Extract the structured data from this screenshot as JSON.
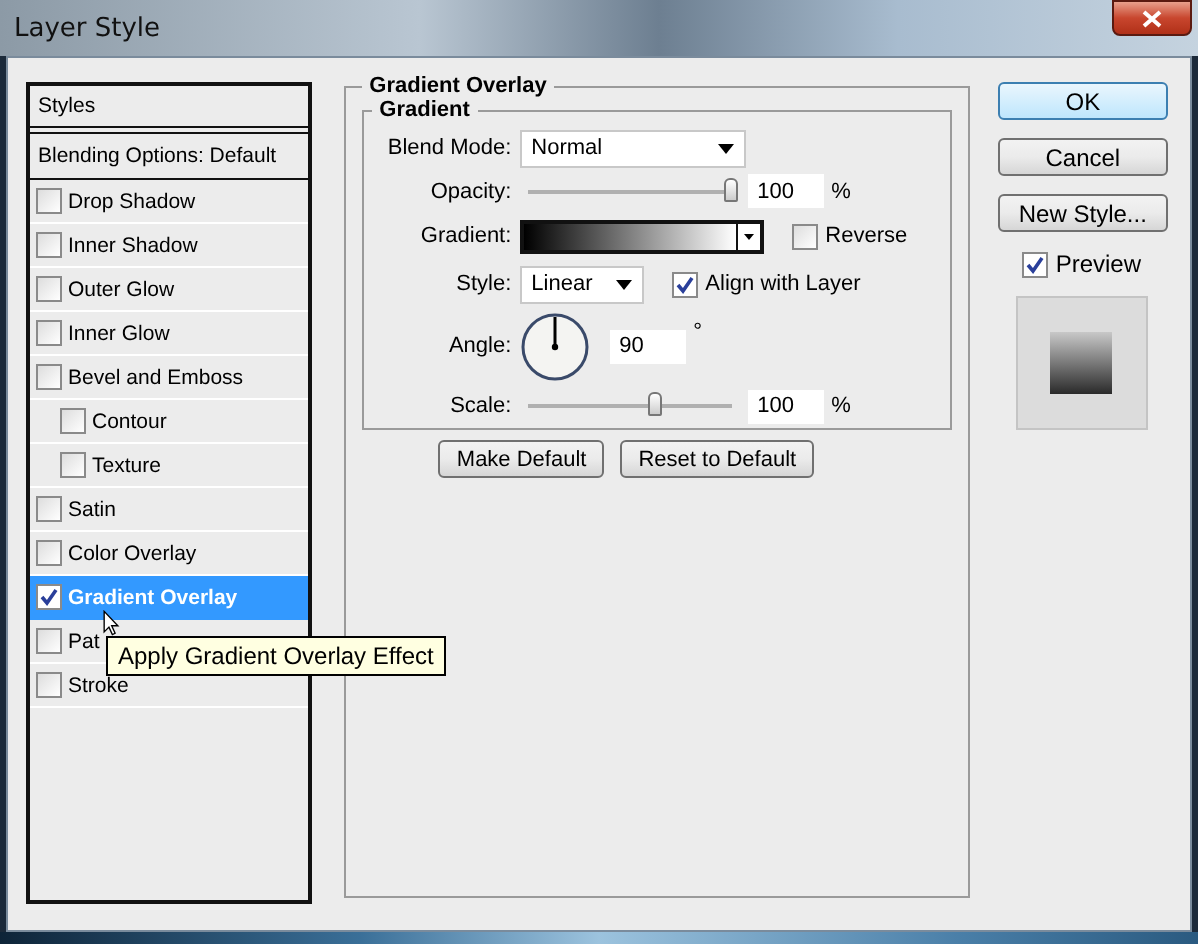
{
  "window": {
    "title": "Layer Style"
  },
  "styles_panel": {
    "title": "Styles",
    "blending_options": "Blending Options: Default",
    "items": [
      {
        "label": "Drop Shadow",
        "checked": false,
        "selected": false
      },
      {
        "label": "Inner Shadow",
        "checked": false,
        "selected": false
      },
      {
        "label": "Outer Glow",
        "checked": false,
        "selected": false
      },
      {
        "label": "Inner Glow",
        "checked": false,
        "selected": false
      },
      {
        "label": "Bevel and Emboss",
        "checked": false,
        "selected": false,
        "children": [
          {
            "label": "Contour",
            "checked": false,
            "selected": false
          },
          {
            "label": "Texture",
            "checked": false,
            "selected": false
          }
        ]
      },
      {
        "label": "Satin",
        "checked": false,
        "selected": false
      },
      {
        "label": "Color Overlay",
        "checked": false,
        "selected": false
      },
      {
        "label": "Gradient Overlay",
        "checked": true,
        "selected": true
      },
      {
        "label": "Pat",
        "checked": false,
        "selected": false
      },
      {
        "label": "Stroke",
        "checked": false,
        "selected": false
      }
    ]
  },
  "gradient_overlay": {
    "title": "Gradient Overlay",
    "gradient": {
      "title": "Gradient",
      "blend_mode": {
        "label": "Blend Mode:",
        "value": "Normal"
      },
      "opacity": {
        "label": "Opacity:",
        "level": 1,
        "value": "100",
        "unit": "%"
      },
      "gradient": {
        "label": "Gradient:"
      },
      "reverse": {
        "label": "Reverse",
        "checked": false
      },
      "style": {
        "label": "Style:",
        "value": "Linear"
      },
      "align_with_layer": {
        "label": "Align with Layer",
        "checked": true
      },
      "angle": {
        "label": "Angle:",
        "value": "90",
        "unit": "°"
      },
      "scale": {
        "label": "Scale:",
        "level": 0.63,
        "value": "100",
        "unit": "%"
      }
    },
    "buttons": [
      "Make Default",
      "Reset to Default"
    ]
  },
  "buttons": [
    {
      "label": "OK",
      "default": true
    },
    {
      "label": "Cancel",
      "default": false
    },
    {
      "label": "New Style...",
      "default": false
    }
  ],
  "preview": {
    "label": "Preview",
    "checked": true
  },
  "tooltip": {
    "text": "Apply Gradient Overlay Effect"
  }
}
